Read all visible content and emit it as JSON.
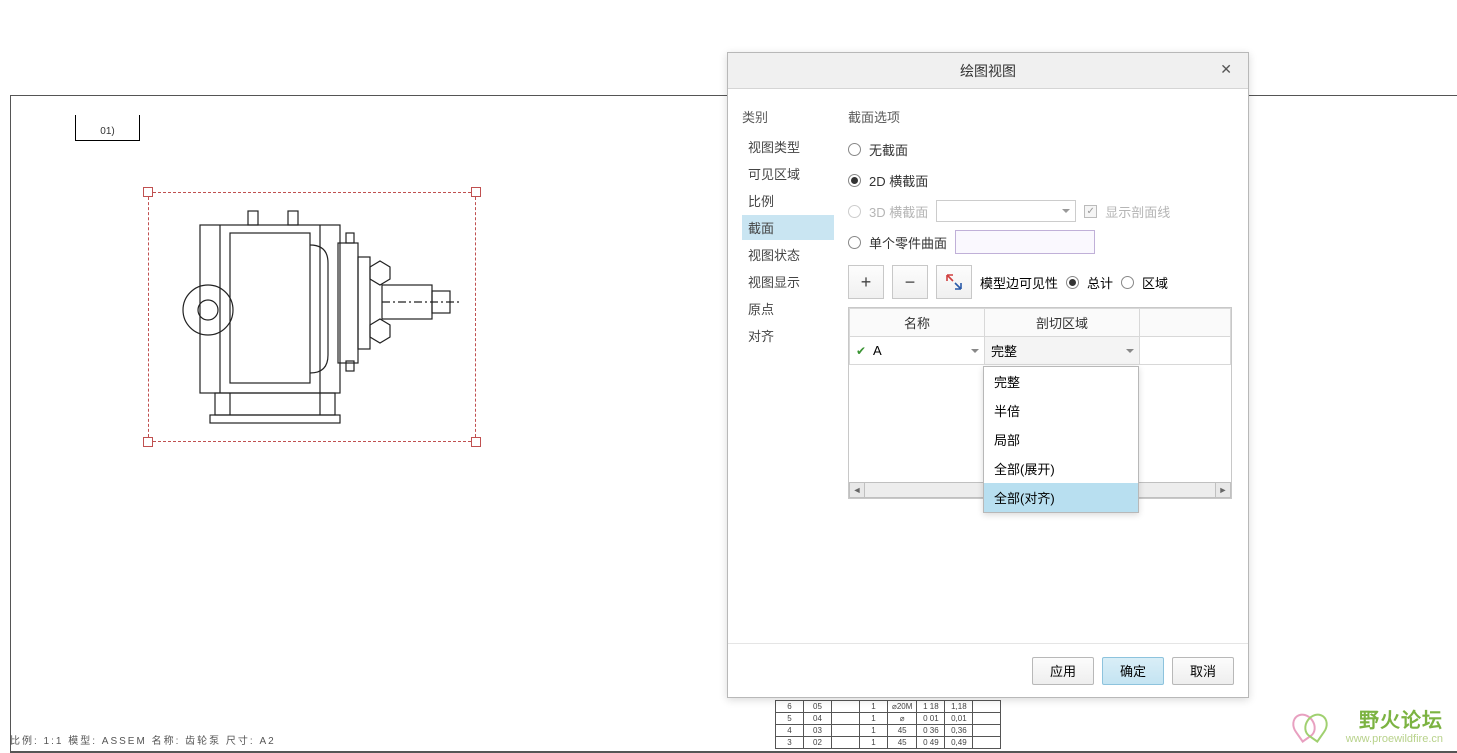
{
  "sheet_label": "01)",
  "footer": "比例: 1:1    模型: ASSEM   名称: 齿轮泵   尺寸: A2",
  "dialog": {
    "title": "绘图视图",
    "category_label": "类别",
    "categories": [
      "视图类型",
      "可见区域",
      "比例",
      "截面",
      "视图状态",
      "视图显示",
      "原点",
      "对齐"
    ],
    "selected_category": "截面",
    "section_heading": "截面选项",
    "radios": {
      "none": "无截面",
      "r2d": "2D 横截面",
      "r3d": "3D 横截面",
      "single": "单个零件曲面"
    },
    "show_section_line": "显示剖面线",
    "visibility_label": "模型边可见性",
    "vis_total": "总计",
    "vis_region": "区域",
    "table": {
      "col_name": "名称",
      "col_region": "剖切区域",
      "row_name": "A",
      "row_region": "完整"
    },
    "dropdown": {
      "options": [
        "完整",
        "半倍",
        "局部",
        "全部(展开)",
        "全部(对齐)"
      ],
      "highlighted": "全部(对齐)"
    },
    "buttons": {
      "apply": "应用",
      "ok": "确定",
      "cancel": "取消"
    }
  },
  "bom": [
    [
      "6",
      "05",
      "",
      "1",
      "⌀20M",
      "1 18",
      "1,18",
      ""
    ],
    [
      "5",
      "04",
      "",
      "1",
      "⌀",
      "0 01",
      "0,01",
      ""
    ],
    [
      "4",
      "03",
      "",
      "1",
      "45",
      "0 36",
      "0,36",
      ""
    ],
    [
      "3",
      "02",
      "",
      "1",
      "45",
      "0 49",
      "0,49",
      ""
    ]
  ],
  "watermark": {
    "title": "野火论坛",
    "sub": "www.proewildfire.cn"
  }
}
